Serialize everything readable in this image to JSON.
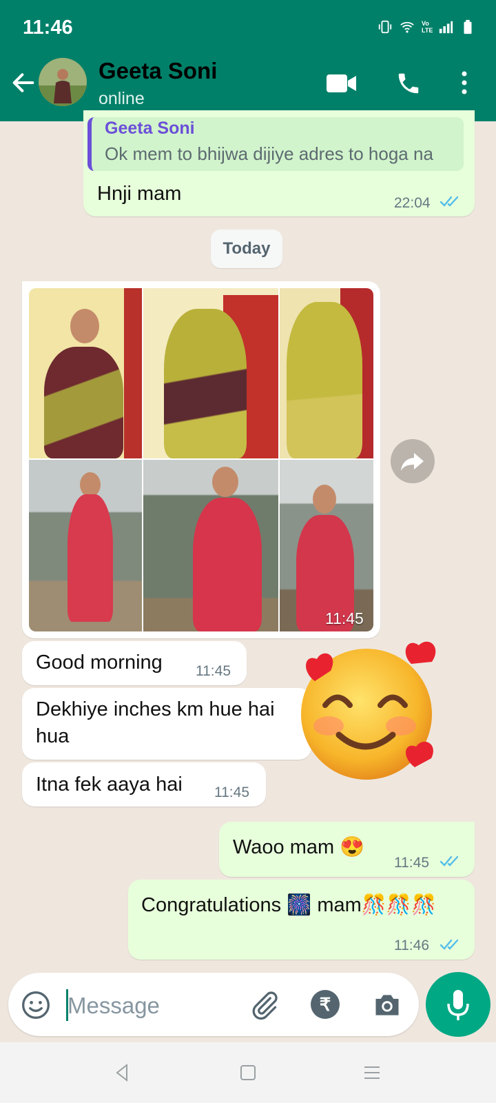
{
  "status_bar": {
    "time": "11:46",
    "network": "Vo LTE"
  },
  "header": {
    "contact_name": "Geeta Soni",
    "contact_status": "online"
  },
  "messages": {
    "reply": {
      "quoted_name": "Geeta Soni",
      "quoted_text": "Ok mem to bhijwa dijiye adres to hoga na",
      "text": "Hnji mam",
      "time": "22:04"
    },
    "date_chip": "Today",
    "photo_album": {
      "time": "11:45",
      "photo_count": 6
    },
    "in_1": {
      "text": "Good morning",
      "time": "11:45"
    },
    "in_2": {
      "line1": "Dekhiye inches km hue hai",
      "line2": "hua"
    },
    "in_3": {
      "text": "Itna fek aaya hai",
      "time": "11:45"
    },
    "out_1": {
      "text": "Waoo mam 😍",
      "time": "11:45"
    },
    "out_2": {
      "text": "Congratulations 🎆 mam🎊🎊🎊",
      "time": "11:46"
    }
  },
  "composer": {
    "placeholder": "Message",
    "rupee": "₹"
  },
  "colors": {
    "header": "#008069",
    "accent": "#00a884",
    "outgoing_bubble": "#e7ffdb",
    "read_ticks": "#53bdeb"
  }
}
